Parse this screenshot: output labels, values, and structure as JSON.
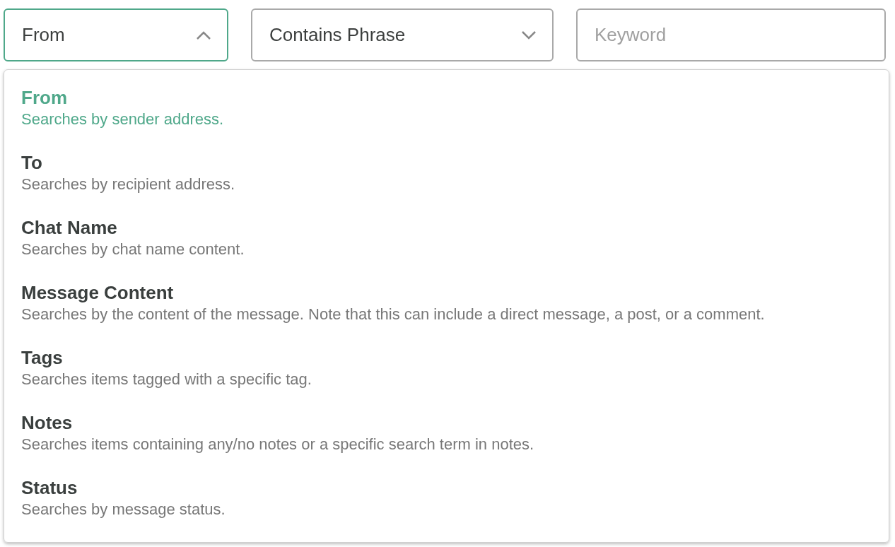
{
  "field_select": {
    "value": "From",
    "expanded": true
  },
  "operator_select": {
    "value": "Contains Phrase",
    "expanded": false
  },
  "keyword": {
    "placeholder": "Keyword"
  },
  "options": [
    {
      "title": "From",
      "description": "Searches by sender address.",
      "selected": true
    },
    {
      "title": "To",
      "description": "Searches by recipient address.",
      "selected": false
    },
    {
      "title": "Chat Name",
      "description": "Searches by chat name content.",
      "selected": false
    },
    {
      "title": "Message Content",
      "description": "Searches by the content of the message. Note that this can include a direct message, a post, or a comment.",
      "selected": false
    },
    {
      "title": "Tags",
      "description": "Searches items tagged with a specific tag.",
      "selected": false
    },
    {
      "title": "Notes",
      "description": "Searches items containing any/no notes or a specific search term in notes.",
      "selected": false
    },
    {
      "title": "Status",
      "description": "Searches by message status.",
      "selected": false
    }
  ]
}
